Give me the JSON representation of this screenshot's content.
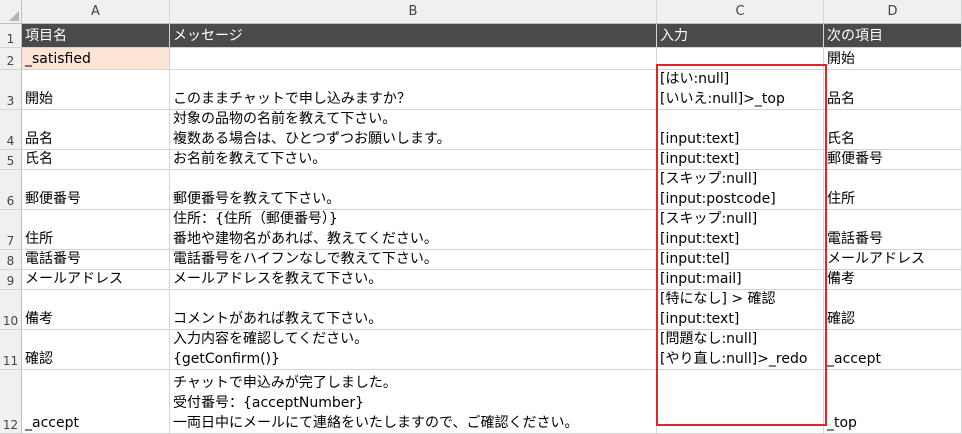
{
  "column_headers": [
    "A",
    "B",
    "C",
    "D"
  ],
  "row_numbers": [
    "1",
    "2",
    "3",
    "4",
    "5",
    "6",
    "7",
    "8",
    "9",
    "10",
    "11",
    "12"
  ],
  "rows": [
    {
      "a": [
        "項目名"
      ],
      "b": [
        "メッセージ"
      ],
      "c": [
        "入力"
      ],
      "d": [
        "次の項目"
      ]
    },
    {
      "a": [
        "_satisfied"
      ],
      "b": [],
      "c": [],
      "d": [
        "開始"
      ]
    },
    {
      "a": [
        "開始"
      ],
      "b": [
        "このままチャットで申し込みますか？"
      ],
      "c": [
        "[はい:null]",
        "[いいえ:null]>_top"
      ],
      "d": [
        "品名"
      ]
    },
    {
      "a": [
        "品名"
      ],
      "b": [
        "対象の品物の名前を教えて下さい。",
        "複数ある場合は、ひとつずつお願いします。"
      ],
      "c": [
        "[input:text]"
      ],
      "d": [
        "氏名"
      ]
    },
    {
      "a": [
        "氏名"
      ],
      "b": [
        "お名前を教えて下さい。"
      ],
      "c": [
        "[input:text]"
      ],
      "d": [
        "郵便番号"
      ]
    },
    {
      "a": [
        "郵便番号"
      ],
      "b": [
        "郵便番号を教えて下さい。"
      ],
      "c": [
        "[スキップ:null]",
        "[input:postcode]"
      ],
      "d": [
        "住所"
      ]
    },
    {
      "a": [
        "住所"
      ],
      "b": [
        "住所：{住所（郵便番号）}",
        "番地や建物名があれば、教えてください。"
      ],
      "c": [
        "[スキップ:null]",
        "[input:text]"
      ],
      "d": [
        "電話番号"
      ]
    },
    {
      "a": [
        "電話番号"
      ],
      "b": [
        "電話番号をハイフンなしで教えて下さい。"
      ],
      "c": [
        "[input:tel]"
      ],
      "d": [
        "メールアドレス"
      ]
    },
    {
      "a": [
        "メールアドレス"
      ],
      "b": [
        "メールアドレスを教えて下さい。"
      ],
      "c": [
        "[input:mail]"
      ],
      "d": [
        "備考"
      ]
    },
    {
      "a": [
        "備考"
      ],
      "b": [
        "コメントがあれば教えて下さい。"
      ],
      "c": [
        "[特になし] > 確認",
        "[input:text]"
      ],
      "d": [
        "確認"
      ]
    },
    {
      "a": [
        "確認"
      ],
      "b": [
        "入力内容を確認してください。",
        "{getConfirm()}"
      ],
      "c": [
        "[問題なし:null]",
        "[やり直し:null]>_redo"
      ],
      "d": [
        "_accept"
      ]
    },
    {
      "a": [
        "_accept"
      ],
      "b": [
        "チャットで申込みが完了しました。",
        "受付番号：{acceptNumber}",
        "一両日中にメールにて連絡をいたしますので、ご確認ください。"
      ],
      "c": [],
      "d": [
        "_top"
      ]
    }
  ],
  "colors": {
    "header_row_bg": "#4a4a4a",
    "header_row_text": "#ffffff",
    "highlight_cell": "#fce4d6",
    "selection_box": "#e1262b"
  }
}
